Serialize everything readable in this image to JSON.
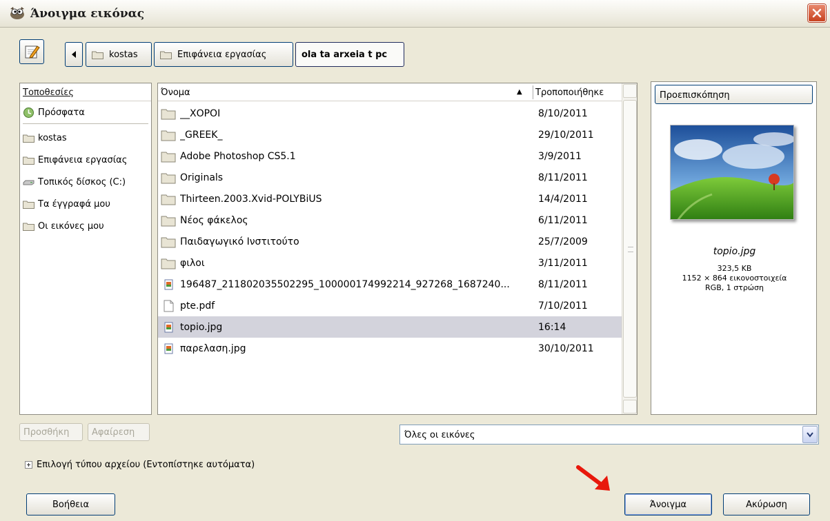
{
  "window": {
    "title": "Άνοιγμα εικόνας",
    "app_icon": "gimp-wilber-icon",
    "close_icon": "close-icon"
  },
  "location_bar": {
    "edit_icon": "pencil-edit-icon",
    "back_icon": "left-arrow-icon",
    "crumbs": [
      "kostas",
      "Επιφάνεια εργασίας",
      "ola ta arxeia t pc"
    ]
  },
  "places": {
    "header": "Τοποθεσίες",
    "items": [
      {
        "label": "Πρόσφατα",
        "icon": "recent-icon"
      },
      {
        "label": "kostas",
        "icon": "folder-icon"
      },
      {
        "label": "Επιφάνεια εργασίας",
        "icon": "folder-icon"
      },
      {
        "label": "Τοπικός δίσκος (C:)",
        "icon": "drive-icon"
      },
      {
        "label": "Τα έγγραφά μου",
        "icon": "folder-icon"
      },
      {
        "label": "Οι εικόνες μου",
        "icon": "folder-icon"
      }
    ]
  },
  "files": {
    "col_name": "Όνομα",
    "col_modified": "Τροποποιήθηκε",
    "rows": [
      {
        "name": "__ΧΟΡΟΙ",
        "date": "8/10/2011",
        "icon": "folder-icon"
      },
      {
        "name": "_GREEK_",
        "date": "29/10/2011",
        "icon": "folder-icon"
      },
      {
        "name": "Adobe Photoshop CS5.1",
        "date": "3/9/2011",
        "icon": "folder-icon"
      },
      {
        "name": "Originals",
        "date": "8/11/2011",
        "icon": "folder-icon"
      },
      {
        "name": "Thirteen.2003.Xvid-POLYBiUS",
        "date": "14/4/2011",
        "icon": "folder-icon"
      },
      {
        "name": "Νέος φάκελος",
        "date": "6/11/2011",
        "icon": "folder-icon"
      },
      {
        "name": "Παιδαγωγικό  Ινστιτούτο",
        "date": "25/7/2009",
        "icon": "folder-icon"
      },
      {
        "name": "φιλοι",
        "date": "3/11/2011",
        "icon": "folder-icon"
      },
      {
        "name": "196487_211802035502295_100000174992214_927268_1687240...",
        "date": "8/11/2011",
        "icon": "image-file-icon"
      },
      {
        "name": "pte.pdf",
        "date": "7/10/2011",
        "icon": "document-icon"
      },
      {
        "name": "topio.jpg",
        "date": "16:14",
        "icon": "image-file-icon",
        "selected": true
      },
      {
        "name": "παρελαση.jpg",
        "date": "30/10/2011",
        "icon": "image-file-icon"
      }
    ]
  },
  "preview": {
    "label": "Προεπισκόπηση",
    "filename": "topio.jpg",
    "size": "323,5 KB",
    "dimensions": "1152 × 864 εικονοστοιχεία",
    "mode": "RGB, 1 στρώση"
  },
  "buttons": {
    "add": "Προσθήκη",
    "remove": "Αφαίρεση",
    "help": "Βοήθεια",
    "open": "Άνοιγμα",
    "cancel": "Ακύρωση"
  },
  "filter": {
    "selected": "Όλες οι εικόνες"
  },
  "file_type": {
    "label": "Επιλογή τύπου αρχείου (Εντοπίστηκε αυτόματα)"
  },
  "annotation": {
    "arrow_color": "#e8180c"
  }
}
